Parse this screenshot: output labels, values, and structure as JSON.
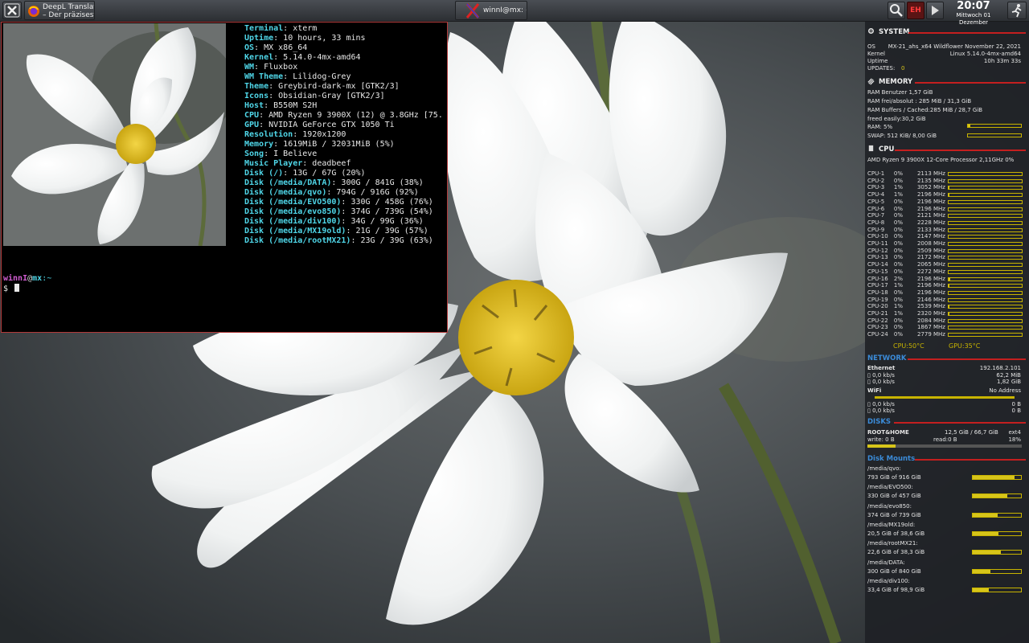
{
  "colors": {
    "accent_red": "#c41f1f",
    "bar_yellow": "#d7c51a",
    "net_blue": "#3b8bd8",
    "terminal_key": "#4fd6e8",
    "prompt_user": "#d05cd0"
  },
  "taskbar": {
    "tasks": [
      {
        "icon": "firefox-icon",
        "line1": "DeepL Translate",
        "line2": "– Der präziseste..."
      },
      {
        "icon": "xterm-icon",
        "label": "winnI@mx: ~"
      }
    ],
    "clock": {
      "time": "20:07",
      "date": "Mittwoch 01 Dezember"
    },
    "tray": [
      "search-icon",
      "keyboard-layout-icon",
      "media-play-icon"
    ],
    "keyboard_layout": "EH"
  },
  "terminal": {
    "neofetch": [
      {
        "key": "Terminal",
        "value": "xterm"
      },
      {
        "key": "Uptime",
        "value": "10 hours, 33 mins"
      },
      {
        "key": "OS",
        "value": "MX x86_64"
      },
      {
        "key": "Kernel",
        "value": "5.14.0-4mx-amd64"
      },
      {
        "key": "WM",
        "value": "Fluxbox"
      },
      {
        "key": "WM Theme",
        "value": "Lilidog-Grey"
      },
      {
        "key": "Theme",
        "value": "Greybird-dark-mx [GTK2/3]"
      },
      {
        "key": "Icons",
        "value": "Obsidian-Gray [GTK2/3]"
      },
      {
        "key": "Host",
        "value": "B550M S2H"
      },
      {
        "key": "CPU",
        "value": "AMD Ryzen 9 3900X (12) @ 3.8GHz [75."
      },
      {
        "key": "GPU",
        "value": "NVIDIA GeForce GTX 1050 Ti"
      },
      {
        "key": "Resolution",
        "value": "1920x1200"
      },
      {
        "key": "Memory",
        "value": "1619MiB / 32031MiB (5%)"
      },
      {
        "key": "Song",
        "value": "I Believe"
      },
      {
        "key": "Music Player",
        "value": "deadbeef"
      },
      {
        "key": "Disk (/)",
        "value": "13G / 67G (20%)"
      },
      {
        "key": "Disk (/media/DATA)",
        "value": "300G / 841G (38%)"
      },
      {
        "key": "Disk (/media/qvo)",
        "value": "794G / 916G (92%)"
      },
      {
        "key": "Disk (/media/EVO500)",
        "value": "330G / 458G (76%)"
      },
      {
        "key": "Disk (/media/evo850)",
        "value": "374G / 739G (54%)"
      },
      {
        "key": "Disk (/media/div100)",
        "value": "34G / 99G (36%)"
      },
      {
        "key": "Disk (/media/MX19old)",
        "value": "21G / 39G (57%)"
      },
      {
        "key": "Disk (/media/rootMX21)",
        "value": "23G / 39G (63%)"
      }
    ],
    "prompt": {
      "user": "winnI",
      "at": "@",
      "host": "mx",
      "dir": ":~",
      "sign": "$"
    }
  },
  "conky": {
    "system": {
      "heading": "SYSTEM",
      "os_label": "OS",
      "os_value": "MX-21_ahs_x64 Wildflower November 22, 2021",
      "kernel_label": "Kernel",
      "kernel_value": "Linux 5.14.0-4mx-amd64",
      "uptime_label": "Uptime",
      "uptime_value": "10h 33m 33s",
      "updates_label": "UPDATES:",
      "updates_value": "0"
    },
    "memory": {
      "heading": "MEMORY",
      "lines": [
        "RAM Benutzer 1,57 GiB",
        "RAM frei/absolut : 285 MiB / 31,3 GiB",
        "RAM Buffers / Cached:285 MiB / 28,7 GiB",
        "freed easily:30,2 GiB"
      ],
      "ram_label": "RAM: 5%",
      "ram_percent": 5,
      "swap_label": "SWAP: 512 KiB/ 8,00 GiB",
      "swap_percent": 0
    },
    "cpu": {
      "heading": "CPU",
      "model": "AMD Ryzen 9 3900X 12-Core Processor 2,11GHz  0%",
      "cores": [
        {
          "name": "CPU-1",
          "pct": "0%",
          "mhz": "2113 MHz",
          "load": 0
        },
        {
          "name": "CPU-2",
          "pct": "0%",
          "mhz": "2135 MHz",
          "load": 0
        },
        {
          "name": "CPU-3",
          "pct": "1%",
          "mhz": "3052 MHz",
          "load": 1
        },
        {
          "name": "CPU-4",
          "pct": "1%",
          "mhz": "2196 MHz",
          "load": 1
        },
        {
          "name": "CPU-5",
          "pct": "0%",
          "mhz": "2196 MHz",
          "load": 0
        },
        {
          "name": "CPU-6",
          "pct": "0%",
          "mhz": "2196 MHz",
          "load": 0
        },
        {
          "name": "CPU-7",
          "pct": "0%",
          "mhz": "2121 MHz",
          "load": 0
        },
        {
          "name": "CPU-8",
          "pct": "0%",
          "mhz": "2228 MHz",
          "load": 0
        },
        {
          "name": "CPU-9",
          "pct": "0%",
          "mhz": "2133 MHz",
          "load": 0
        },
        {
          "name": "CPU-10",
          "pct": "0%",
          "mhz": "2147 MHz",
          "load": 0
        },
        {
          "name": "CPU-11",
          "pct": "0%",
          "mhz": "2008 MHz",
          "load": 0
        },
        {
          "name": "CPU-12",
          "pct": "0%",
          "mhz": "2509 MHz",
          "load": 0
        },
        {
          "name": "CPU-13",
          "pct": "0%",
          "mhz": "2172 MHz",
          "load": 0
        },
        {
          "name": "CPU-14",
          "pct": "0%",
          "mhz": "2065 MHz",
          "load": 0
        },
        {
          "name": "CPU-15",
          "pct": "0%",
          "mhz": "2272 MHz",
          "load": 0
        },
        {
          "name": "CPU-16",
          "pct": "2%",
          "mhz": "2196 MHz",
          "load": 2
        },
        {
          "name": "CPU-17",
          "pct": "1%",
          "mhz": "2196 MHz",
          "load": 1
        },
        {
          "name": "CPU-18",
          "pct": "0%",
          "mhz": "2196 MHz",
          "load": 0
        },
        {
          "name": "CPU-19",
          "pct": "0%",
          "mhz": "2146 MHz",
          "load": 0
        },
        {
          "name": "CPU-20",
          "pct": "1%",
          "mhz": "2539 MHz",
          "load": 1
        },
        {
          "name": "CPU-21",
          "pct": "1%",
          "mhz": "2320 MHz",
          "load": 1
        },
        {
          "name": "CPU-22",
          "pct": "0%",
          "mhz": "2084 MHz",
          "load": 0
        },
        {
          "name": "CPU-23",
          "pct": "0%",
          "mhz": "1867 MHz",
          "load": 0
        },
        {
          "name": "CPU-24",
          "pct": "0%",
          "mhz": "2779 MHz",
          "load": 0
        }
      ],
      "cpu_temp": "CPU:50°C",
      "gpu_temp": "GPU:35°C"
    },
    "network": {
      "heading": "NETWORK",
      "ethernet_label": "Ethernet",
      "ethernet_ip": "192.168.2.101",
      "eth_down": "0,0 kb/s",
      "eth_down_total": "62,2 MiB",
      "eth_up": "0,0 kb/s",
      "eth_up_total": "1,82 GiB",
      "wifi_label": "WiFi",
      "wifi_addr": "No Address",
      "wifi_down": "0,0 kb/s",
      "wifi_down_total": "0 B",
      "wifi_up": "0,0 kb/s",
      "wifi_up_total": "0 B"
    },
    "disks": {
      "heading": "DISKS",
      "root_label": "ROOT&HOME",
      "root_usage": "12,5 GiB / 66,7 GiB",
      "root_fs": "ext4",
      "write": "write: 0 B",
      "read": "read:0 B",
      "root_pct": "18%",
      "root_percent": 18
    },
    "mounts": {
      "heading": "Disk Mounts",
      "items": [
        {
          "path": "/media/qvo:",
          "usage": "793 GiB of 916 GiB",
          "percent": 87
        },
        {
          "path": "/media/EVO500:",
          "usage": "330 GiB of 457 GiB",
          "percent": 72
        },
        {
          "path": "/media/evo850:",
          "usage": "374 GiB of 739 GiB",
          "percent": 51
        },
        {
          "path": "/media/MX19old:",
          "usage": "20,5 GiB of 38,6 GiB",
          "percent": 53
        },
        {
          "path": "/media/rootMX21:",
          "usage": "22,6 GiB of 38,3 GiB",
          "percent": 59
        },
        {
          "path": "/media/DATA:",
          "usage": "300 GiB of 840 GiB",
          "percent": 36
        },
        {
          "path": "/media/div100:",
          "usage": "33,4 GiB of 98,9 GiB",
          "percent": 34
        }
      ]
    }
  }
}
